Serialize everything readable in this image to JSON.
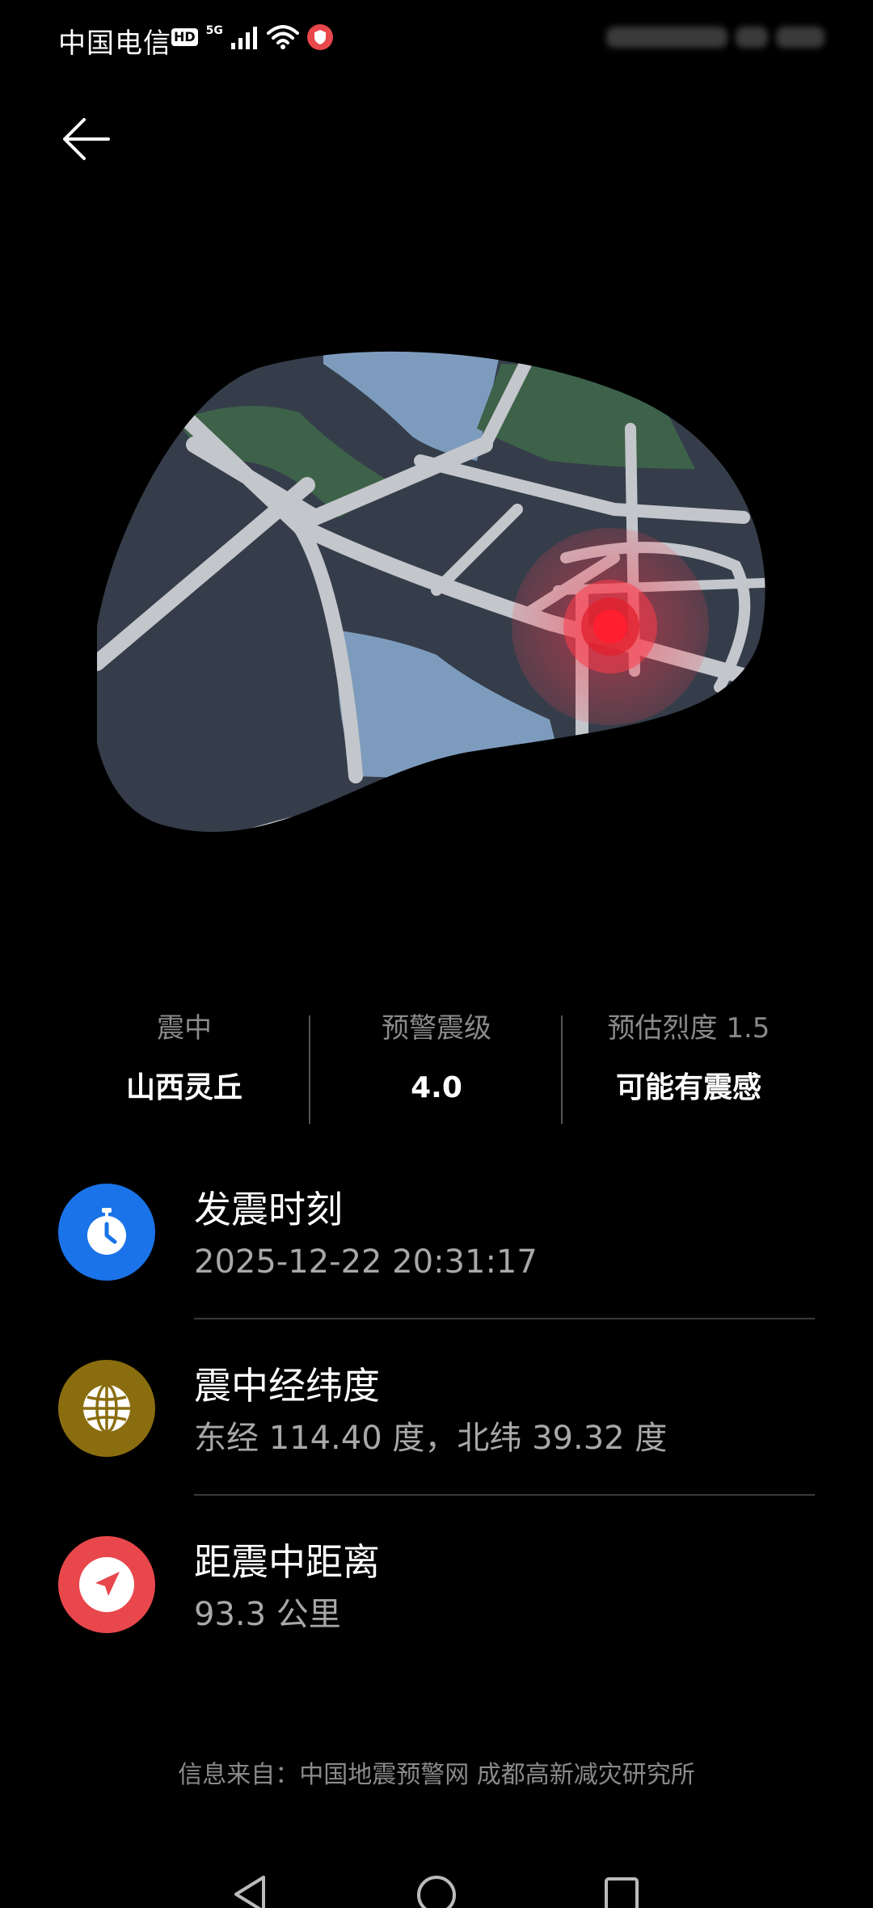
{
  "status_bar": {
    "carrier": "中国电信",
    "hd_badge": "HD",
    "network": "5G"
  },
  "icons": {
    "back": "back-arrow-icon",
    "time": "stopwatch-icon",
    "coordinates": "globe-icon",
    "distance": "location-arrow-icon",
    "nav_back": "triangle-back-icon",
    "nav_home": "circle-home-icon",
    "nav_recent": "square-recent-icon"
  },
  "colors": {
    "background": "#000000",
    "map_land": "#353d4a",
    "map_road": "#c3c6cb",
    "map_water": "#7d9cbd",
    "map_park": "#3d6249",
    "epicenter": "#ff1f2f",
    "time_icon_bg": "#1a73e8",
    "coord_icon_bg": "#8a6d0e",
    "distance_icon_bg": "#e8474c"
  },
  "summary": [
    {
      "label": "震中",
      "value": "山西灵丘"
    },
    {
      "label": "预警震级",
      "value": "4.0"
    },
    {
      "label": "预估烈度 1.5",
      "value": "可能有震感"
    }
  ],
  "details": [
    {
      "title": "发震时刻",
      "value": "2025-12-22 20:31:17"
    },
    {
      "title": "震中经纬度",
      "value": "东经 114.40 度，北纬 39.32 度"
    },
    {
      "title": "距震中距离",
      "value": "93.3 公里"
    }
  ],
  "footer": {
    "source": "信息来自：中国地震预警网 成都高新减灾研究所"
  }
}
